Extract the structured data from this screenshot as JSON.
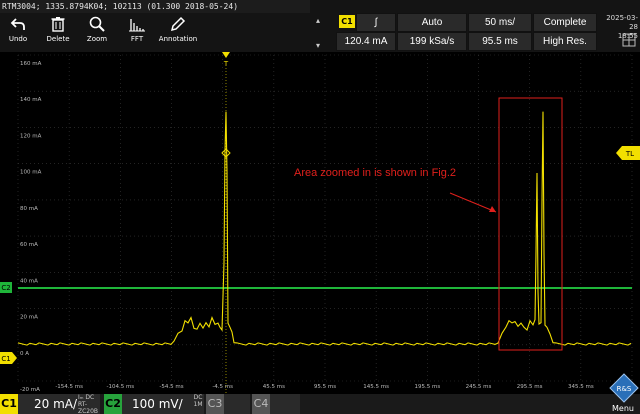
{
  "title_bar": {
    "text": "RTM3004; 1335.8794K04; 102113 (01.300 2018-05-24)"
  },
  "toolbar": {
    "undo_label": "Undo",
    "delete_label": "Delete",
    "zoom_label": "Zoom",
    "fft_label": "FFT",
    "annotation_label": "Annotation"
  },
  "status": {
    "channel_badge": "C1",
    "trigger_slope": "∫",
    "trigger_level": "120.4 mA",
    "trigger_mode": "Auto",
    "sample_rate": "199 kSa/s",
    "time_scale": "50 ms/",
    "horizontal_position": "95.5 ms",
    "acquisition_state": "Complete",
    "acquisition_mode": "High Res."
  },
  "datetime": {
    "date": "2025-03-28",
    "time": "18:55"
  },
  "plot": {
    "y_ticks": [
      "160 mA",
      "140 mA",
      "120 mA",
      "100 mA",
      "80 mA",
      "60 mA",
      "40 mA",
      "20 mA",
      "0 A",
      "-20 mA"
    ],
    "x_ticks": [
      "-154.5 ms",
      "-104.5 ms",
      "-54.5 ms",
      "-4.5 ms",
      "45.5 ms",
      "95.5 ms",
      "145.5 ms",
      "195.5 ms",
      "245.5 ms",
      "295.5 ms",
      "345.5 ms"
    ],
    "trigger_marker": "T",
    "trigger_level_marker": "TL",
    "ch1_marker": "C1",
    "ch2_marker": "C2",
    "annotation_text": "Area zoomed in is shown in Fig.2",
    "colors": {
      "ch1": "#f2df00",
      "ch2": "#1fb53a",
      "annotation": "#e0201c",
      "grid": "#3a3a3a"
    }
  },
  "channels": {
    "ch1": {
      "tag": "C1",
      "scale": "20 mA/",
      "probe": "RT-ZC20B",
      "coupling_sup": "Iₘ DC"
    },
    "ch2": {
      "tag": "C2",
      "scale": "100 mV/",
      "coupling": "DC",
      "impedance": "1M"
    },
    "ch3": {
      "tag": "C3"
    },
    "ch4": {
      "tag": "C4"
    }
  },
  "menu": {
    "label": "Menu",
    "brand": "R&S"
  }
}
